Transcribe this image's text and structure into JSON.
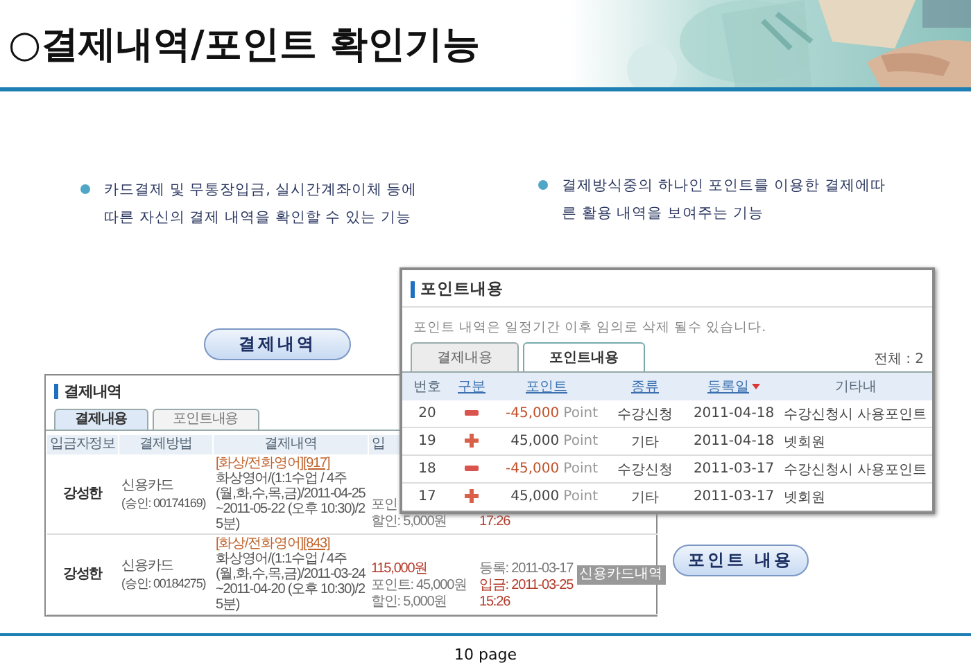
{
  "slide": {
    "title": "○결제내역/포인트 확인기능",
    "page": "10 page"
  },
  "bullets": [
    {
      "lines": [
        "카드결제 및 무통장입금, 실시간계좌이체 등에",
        "따른 자신의 결제 내역을 확인할 수 있는 기능"
      ]
    },
    {
      "lines": [
        "결제방식중의 하나인 포인트를 이용한 결제에따",
        "른 활용 내역을 보여주는 기능"
      ]
    }
  ],
  "callouts": [
    "결제내역",
    "포인트 내용"
  ],
  "payment_panel": {
    "title": "결제내역",
    "tabs": [
      {
        "label": "결제내용",
        "selected": true
      },
      {
        "label": "포인트내용",
        "selected": false
      }
    ],
    "columns": [
      "입금자정보",
      "결제방법",
      "결제내역",
      "입"
    ],
    "rows": [
      {
        "payer": "강성한",
        "method": "신용카드",
        "approval": "(승인: 00174169)",
        "category": "[화상/전화영어]",
        "code": "[917]",
        "detail": "화상영어/(1:1수업 / 4주(월,화,수,목,금)/2011-04-25~2011-05-22 (오후 10:30)/25분)",
        "amounts": [
          {
            "text": "포인",
            "highlight": false
          },
          {
            "text": "할인: 5,000원",
            "highlight": false
          }
        ],
        "dates": [
          {
            "text": "17:26",
            "highlight": true
          }
        ]
      },
      {
        "payer": "강성한",
        "method": "신용카드",
        "approval": "(승인: 00184275)",
        "category": "[화상/전화영어]",
        "code": "[843]",
        "detail": "화상영어/(1:1수업 / 4주(월,화,수,목,금)/2011-03-24~2011-04-20 (오후 10:30)/25분)",
        "amounts": [
          {
            "text": "115,000원",
            "highlight": true
          },
          {
            "text": "포인트: 45,000원",
            "highlight": false
          },
          {
            "text": "할인: 5,000원",
            "highlight": false
          }
        ],
        "dates": [
          {
            "text": "등록: 2011-03-17",
            "highlight": false
          },
          {
            "text": "입금: 2011-03-25",
            "highlight": true
          },
          {
            "text": "15:26",
            "highlight": true
          }
        ],
        "action": "신용카드내역"
      }
    ]
  },
  "points_panel": {
    "title": "포인트내용",
    "note": "포인트 내역은 일정기간 이후 임의로 삭제 될수 있습니다.",
    "tabs": [
      {
        "label": "결제내용",
        "selected": false
      },
      {
        "label": "포인트내용",
        "selected": true
      }
    ],
    "total": "전체 : 2",
    "columns": [
      {
        "label": "번호",
        "link": false,
        "sorted": false
      },
      {
        "label": "구분",
        "link": true,
        "sorted": false
      },
      {
        "label": "포인트",
        "link": true,
        "sorted": false
      },
      {
        "label": "종류",
        "link": true,
        "sorted": false
      },
      {
        "label": "등록일",
        "link": true,
        "sorted": true
      },
      {
        "label": "기타내",
        "link": false,
        "sorted": false
      }
    ],
    "rows": [
      {
        "no": "20",
        "kind": "minus",
        "amount": "-45,000",
        "unit": "Point",
        "type": "수강신청",
        "date": "2011-04-18",
        "memo": "수강신청시 사용포인트"
      },
      {
        "no": "19",
        "kind": "plus",
        "amount": "45,000",
        "unit": "Point",
        "type": "기타",
        "date": "2011-04-18",
        "memo": "넷회원"
      },
      {
        "no": "18",
        "kind": "minus",
        "amount": "-45,000",
        "unit": "Point",
        "type": "수강신청",
        "date": "2011-03-17",
        "memo": "수강신청시 사용포인트"
      },
      {
        "no": "17",
        "kind": "plus",
        "amount": "45,000",
        "unit": "Point",
        "type": "기타",
        "date": "2011-03-17",
        "memo": "넷회원"
      }
    ]
  }
}
